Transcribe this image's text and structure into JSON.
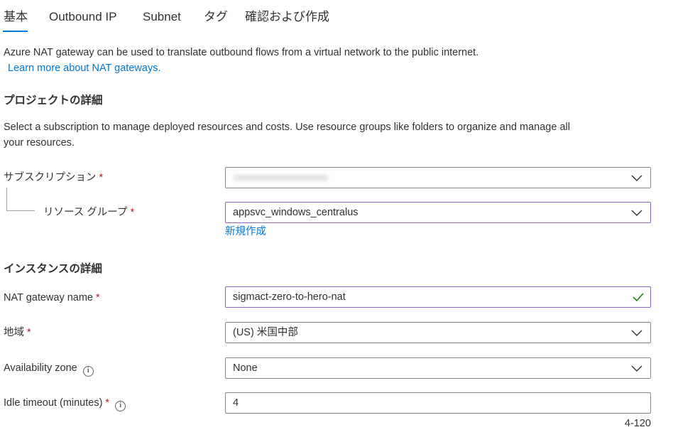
{
  "tabs": [
    {
      "label": "基本",
      "active": true
    },
    {
      "label": "Outbound IP",
      "active": false
    },
    {
      "label": "Subnet",
      "active": false
    },
    {
      "label": "タグ",
      "active": false
    },
    {
      "label": "確認および作成",
      "active": false
    }
  ],
  "intro": {
    "text": "Azure NAT gateway can be used to translate outbound flows from a virtual network to the public internet.",
    "link": "Learn more about NAT gateways."
  },
  "project": {
    "title": "プロジェクトの詳細",
    "desc_line1": "Select a subscription to manage deployed resources and costs. Use resource groups like folders to organize and manage all",
    "desc_line2": "your resources.",
    "subscription_label": "サブスクリプション",
    "resource_group_label": "リソース グループ",
    "resource_group_value": "appsvc_windows_centralus",
    "create_new_link": "新規作成"
  },
  "instance": {
    "title": "インスタンスの詳細",
    "name_label": "NAT gateway name",
    "name_value": "sigmact-zero-to-hero-nat",
    "region_label": "地域",
    "region_value": "(US) 米国中部",
    "zone_label": "Availability zone",
    "zone_value": "None",
    "timeout_label": "Idle timeout (minutes)",
    "timeout_value": "4",
    "timeout_range": "4-120"
  },
  "required_marker": "*",
  "colors": {
    "accent": "#0078d4",
    "required": "#a4262c",
    "focus_border": "#8764b8",
    "valid_check": "#107c10"
  }
}
